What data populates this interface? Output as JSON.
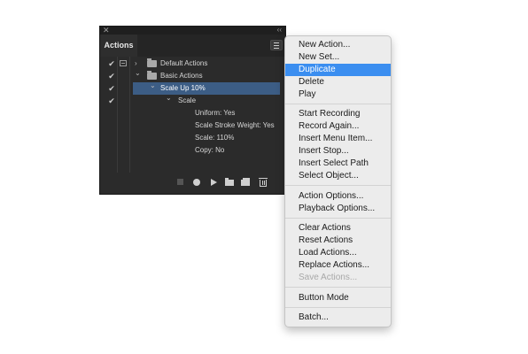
{
  "panel": {
    "close_glyph": "✕",
    "collapse_glyph": "‹‹",
    "tab_label": "Actions",
    "rows": [
      {
        "label": "Default Actions",
        "checked": true,
        "dialog": true,
        "expanded": false
      },
      {
        "label": "Basic Actions",
        "checked": true,
        "dialog": false,
        "expanded": true
      },
      {
        "label": "Scale Up 10%",
        "checked": true,
        "selected": true,
        "expanded": true
      },
      {
        "label": "Scale",
        "checked": true,
        "expanded": true
      },
      {
        "label": "Uniform: Yes"
      },
      {
        "label": "Scale Stroke Weight: Yes"
      },
      {
        "label": "Scale: 110%"
      },
      {
        "label": "Copy: No"
      }
    ],
    "check_glyph": "✔",
    "chevron_right": "›",
    "chevron_down": "⌄",
    "footer_icons": [
      "stop-icon",
      "record-icon",
      "play-icon",
      "folder-icon",
      "new-icon",
      "trash-icon"
    ]
  },
  "menu": {
    "items": [
      {
        "label": "New Action..."
      },
      {
        "label": "New Set..."
      },
      {
        "label": "Duplicate",
        "highlighted": true
      },
      {
        "label": "Delete"
      },
      {
        "label": "Play"
      },
      {
        "label": "Start Recording"
      },
      {
        "label": "Record Again..."
      },
      {
        "label": "Insert Menu Item..."
      },
      {
        "label": "Insert Stop..."
      },
      {
        "label": "Insert Select Path"
      },
      {
        "label": "Select Object..."
      },
      {
        "label": "Action Options..."
      },
      {
        "label": "Playback Options..."
      },
      {
        "label": "Clear Actions"
      },
      {
        "label": "Reset Actions"
      },
      {
        "label": "Load Actions..."
      },
      {
        "label": "Replace Actions..."
      },
      {
        "label": "Save Actions...",
        "disabled": true
      },
      {
        "label": "Button Mode"
      },
      {
        "label": "Batch..."
      }
    ]
  },
  "colors": {
    "panel_bg": "#2b2b2b",
    "selection": "#3c5d85",
    "menu_highlight": "#3b8ef0",
    "menu_bg": "#ececec"
  }
}
